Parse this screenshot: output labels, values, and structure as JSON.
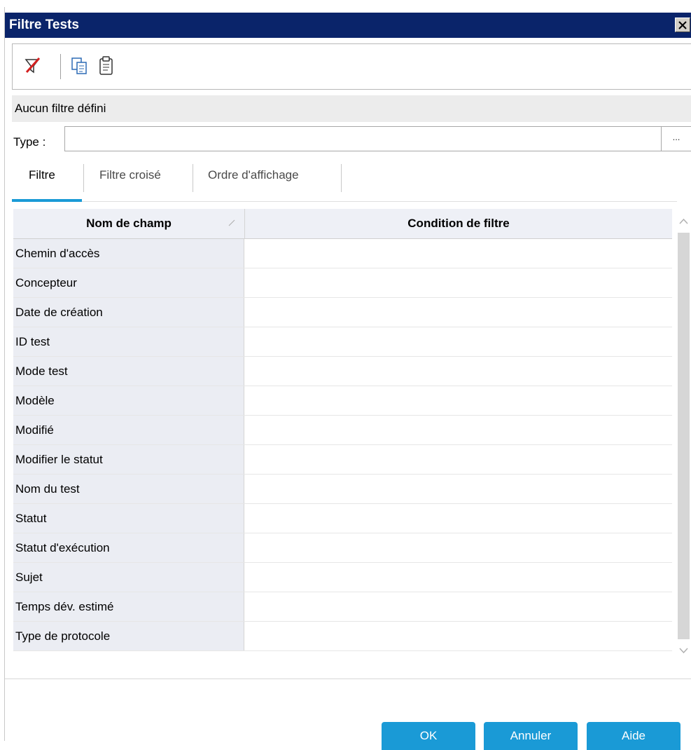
{
  "window": {
    "title": "Filtre Tests",
    "close_glyph": "✕"
  },
  "toolbar": {
    "icons": [
      "clear-filter-icon",
      "copy-icon",
      "paste-icon"
    ]
  },
  "status": {
    "text": "Aucun filtre défini"
  },
  "type_field": {
    "label": "Type :",
    "value": "",
    "browse_label": "..."
  },
  "tabs": [
    {
      "label": "Filtre",
      "active": true
    },
    {
      "label": "Filtre croisé",
      "active": false
    },
    {
      "label": "Ordre d'affichage",
      "active": false
    }
  ],
  "grid": {
    "columns": [
      "Nom de champ",
      "Condition de filtre"
    ],
    "rows": [
      {
        "field": "Chemin d'accès",
        "condition": ""
      },
      {
        "field": "Concepteur",
        "condition": ""
      },
      {
        "field": "Date de création",
        "condition": ""
      },
      {
        "field": "ID test",
        "condition": ""
      },
      {
        "field": "Mode test",
        "condition": ""
      },
      {
        "field": "Modèle",
        "condition": ""
      },
      {
        "field": "Modifié",
        "condition": ""
      },
      {
        "field": "Modifier le statut",
        "condition": ""
      },
      {
        "field": "Nom du test",
        "condition": ""
      },
      {
        "field": "Statut",
        "condition": ""
      },
      {
        "field": "Statut d'exécution",
        "condition": ""
      },
      {
        "field": "Sujet",
        "condition": ""
      },
      {
        "field": "Temps dév. estimé",
        "condition": ""
      },
      {
        "field": "Type de protocole",
        "condition": ""
      }
    ]
  },
  "buttons": {
    "ok": "OK",
    "cancel": "Annuler",
    "help": "Aide"
  },
  "colors": {
    "title_bar": "#0a246a",
    "accent": "#1a9ad6",
    "field_column_bg": "#ebedf3"
  }
}
